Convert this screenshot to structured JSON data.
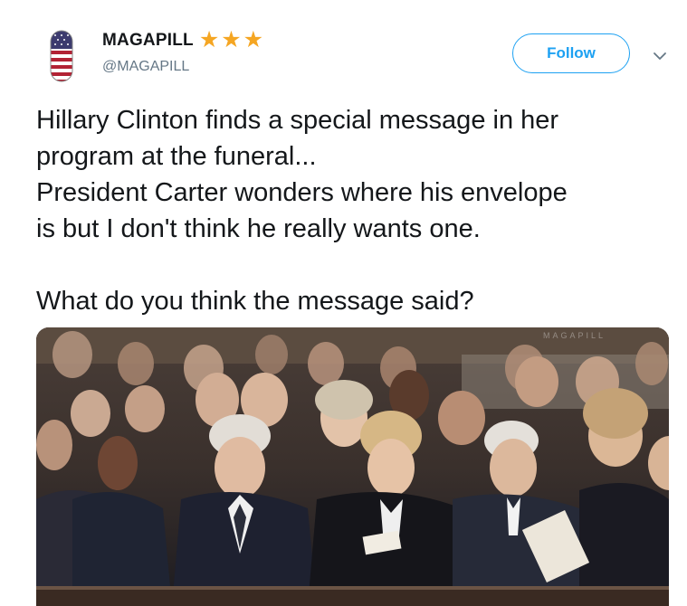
{
  "user": {
    "display_name": "MAGAPILL",
    "handle": "@MAGAPILL",
    "badge_icon": "three-stars-icon",
    "avatar_icon": "american-flag-pill-icon"
  },
  "follow_button": {
    "label": "Follow",
    "color": "#1da1f2"
  },
  "menu": {
    "icon": "chevron-down-icon"
  },
  "tweet": {
    "text": "Hillary Clinton finds a special message in her\nprogram at the funeral...\nPresident Carter wonders where his envelope\nis but I don't think he really wants one.\n\nWhat do you think the message said?"
  },
  "media": {
    "watermark": "MAGAPILL",
    "kind": "photo-of-funeral-attendees"
  },
  "colors": {
    "star": "#f5a623",
    "handle": "#657786",
    "text": "#14171a"
  }
}
